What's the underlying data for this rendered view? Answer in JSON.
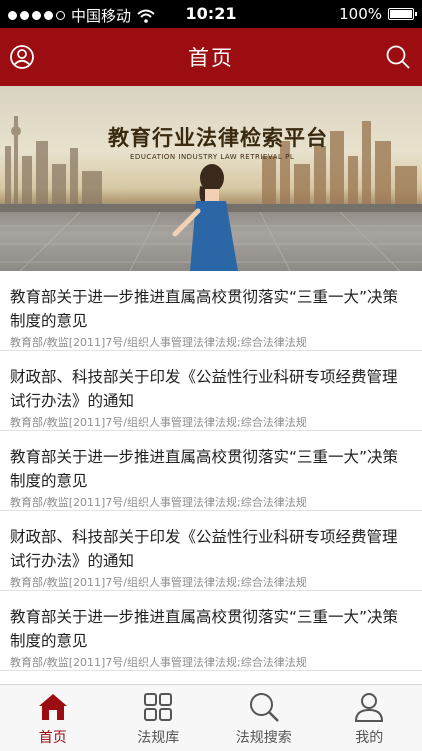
{
  "status_bar": {
    "carrier": "中国移动",
    "time": "10:21",
    "battery": "100%"
  },
  "header": {
    "title": "首页"
  },
  "banner": {
    "title": "教育行业法律检索平台",
    "subtitle": "EDUCATION INDUSTRY LAW RETRIEVAL PL"
  },
  "articles": [
    {
      "title": "教育部关于进一步推进直属高校贯彻落实“三重一大”决策制度的意见",
      "meta": "教育部/教监[2011]7号/组织人事管理法律法规;综合法律法规"
    },
    {
      "title": "财政部、科技部关于印发《公益性行业科研专项经费管理试行办法》的通知",
      "meta": "教育部/教监[2011]7号/组织人事管理法律法规;综合法律法规"
    },
    {
      "title": "教育部关于进一步推进直属高校贯彻落实“三重一大”决策制度的意见",
      "meta": "教育部/教监[2011]7号/组织人事管理法律法规;综合法律法规"
    },
    {
      "title": "财政部、科技部关于印发《公益性行业科研专项经费管理试行办法》的通知",
      "meta": "教育部/教监[2011]7号/组织人事管理法律法规;综合法律法规"
    },
    {
      "title": "教育部关于进一步推进直属高校贯彻落实“三重一大”决策制度的意见",
      "meta": "教育部/教监[2011]7号/组织人事管理法律法规;综合法律法规"
    }
  ],
  "tabs": [
    {
      "label": "首页",
      "icon": "home-icon",
      "active": true
    },
    {
      "label": "法规库",
      "icon": "grid-icon",
      "active": false
    },
    {
      "label": "法规搜索",
      "icon": "search-icon",
      "active": false
    },
    {
      "label": "我的",
      "icon": "user-icon",
      "active": false
    }
  ],
  "colors": {
    "brand": "#9b0d11",
    "inactive": "#555555",
    "meta": "#8f8f8f"
  }
}
